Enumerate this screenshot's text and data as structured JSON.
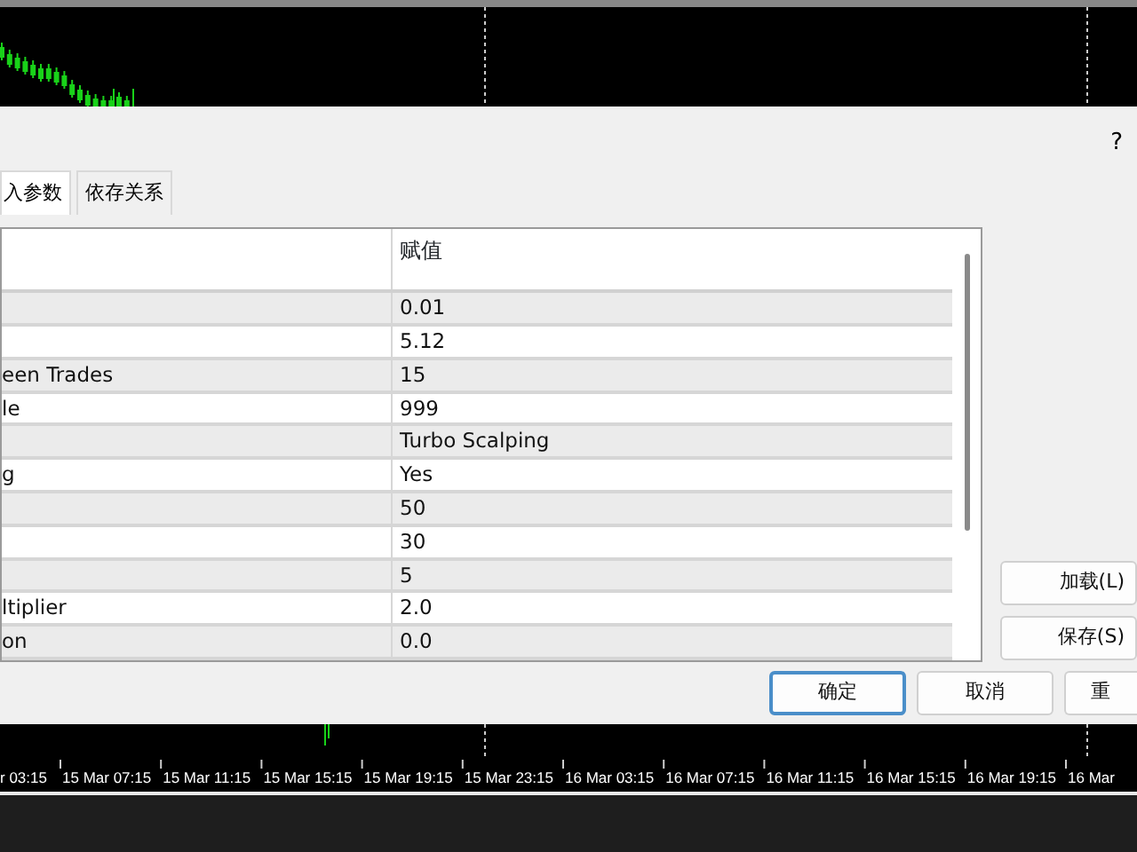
{
  "dialog": {
    "help": "?",
    "tabs": [
      {
        "label": "入参数",
        "selected": true
      },
      {
        "label": "依存关系",
        "selected": false
      }
    ],
    "table": {
      "value_header": "赋值",
      "rows": [
        {
          "value": "0.01"
        },
        {
          "value": "5.12"
        },
        {
          "name": "een Trades",
          "value": "15"
        },
        {
          "name": "le",
          "value": "999"
        },
        {
          "value": "Turbo Scalping"
        },
        {
          "name": "g",
          "value": "Yes"
        },
        {
          "value": "50"
        },
        {
          "value": "30"
        },
        {
          "value": "5"
        },
        {
          "name": "ltiplier",
          "value": "2.0"
        },
        {
          "name": "on",
          "value": "0.0"
        }
      ]
    },
    "side_buttons": [
      "加载(L)",
      "保存(S)"
    ],
    "buttons": [
      {
        "label": "确定",
        "default": true
      },
      {
        "label": "取消",
        "default": false
      },
      {
        "label": "重",
        "default": false
      }
    ]
  },
  "chart": {
    "time_labels": [
      "r 03:15",
      "15 Mar 07:15",
      "15 Mar 11:15",
      "15 Mar 15:15",
      "15 Mar 19:15",
      "15 Mar 23:15",
      "16 Mar 03:15",
      "16 Mar 07:15",
      "16 Mar 11:15",
      "16 Mar 15:15",
      "16 Mar 19:15",
      "16 Mar"
    ]
  }
}
